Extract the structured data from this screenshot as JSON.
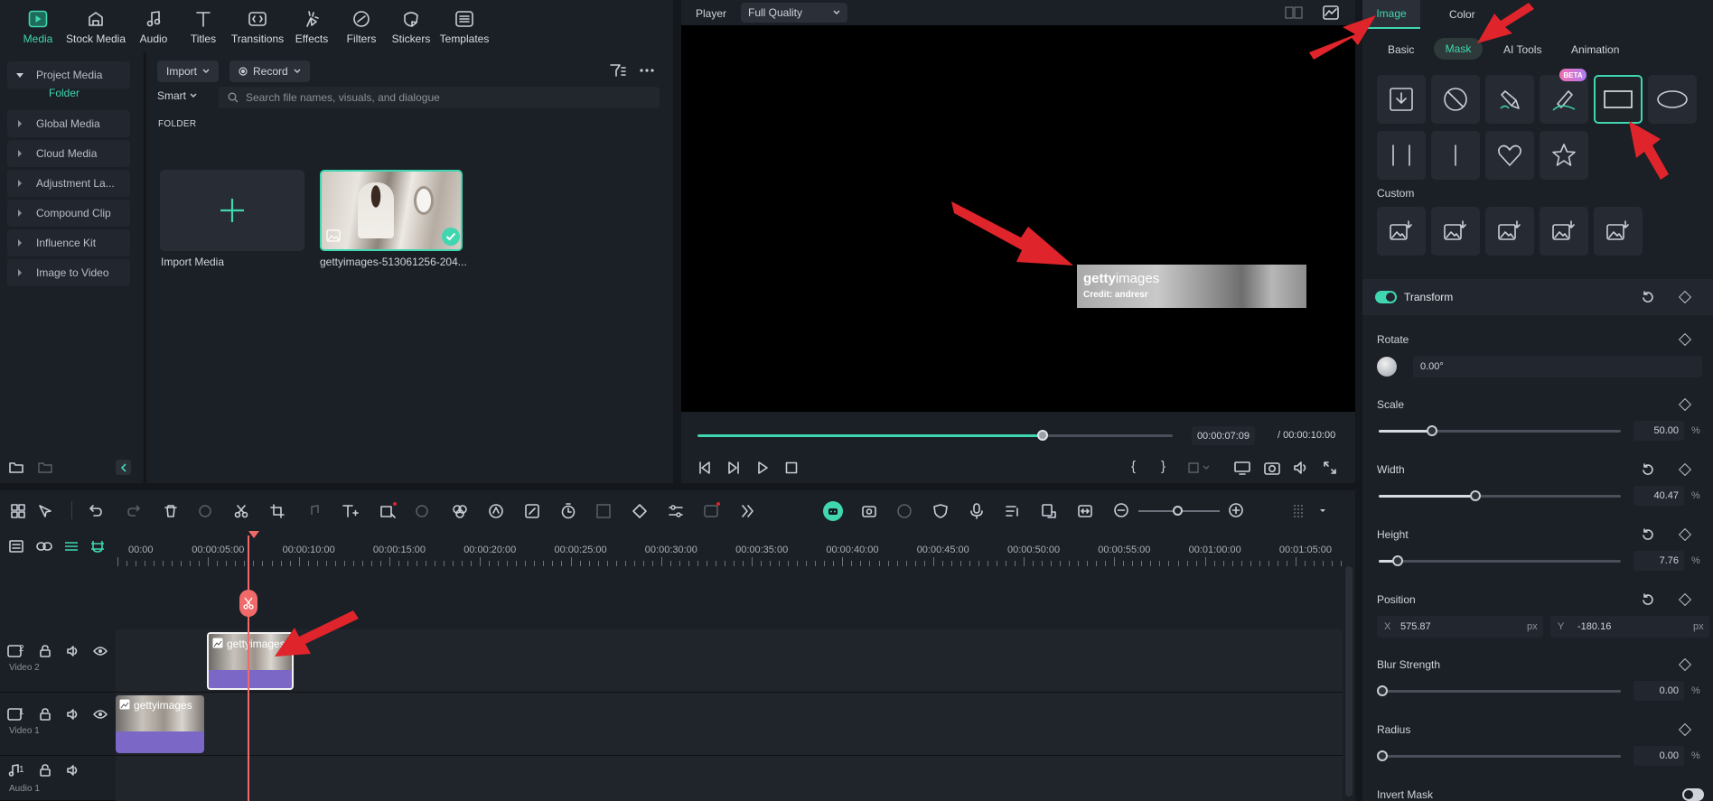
{
  "media_tabs": [
    {
      "label": "Media",
      "icon": "media-icon",
      "active": true
    },
    {
      "label": "Stock Media",
      "icon": "stock-media-icon"
    },
    {
      "label": "Audio",
      "icon": "music-note-icon"
    },
    {
      "label": "Titles",
      "icon": "text-icon"
    },
    {
      "label": "Transitions",
      "icon": "transitions-icon"
    },
    {
      "label": "Effects",
      "icon": "effects-icon"
    },
    {
      "label": "Filters",
      "icon": "filters-icon"
    },
    {
      "label": "Stickers",
      "icon": "sticker-icon"
    },
    {
      "label": "Templates",
      "icon": "templates-icon"
    }
  ],
  "left_panel": {
    "project_media": "Project Media",
    "folder": "Folder",
    "items": [
      "Global Media",
      "Cloud Media",
      "Adjustment La...",
      "Compound Clip",
      "Influence Kit",
      "Image to Video"
    ]
  },
  "media_main": {
    "import_label": "Import",
    "record_label": "Record",
    "smart_label": "Smart",
    "search_placeholder": "Search file names, visuals, and dialogue",
    "folder_header": "FOLDER",
    "import_media_label": "Import Media",
    "media_item_label": "gettyimages-513061256-204..."
  },
  "player": {
    "label": "Player",
    "quality": "Full Quality",
    "watermark_brand_bold": "getty",
    "watermark_brand_rest": "images",
    "watermark_credit": "Credit: andresr",
    "current_time": "00:00:07:09",
    "total_time": "/ 00:00:10:00",
    "progress": 0.727
  },
  "props": {
    "tabs": [
      "Image",
      "Color"
    ],
    "subtabs": [
      "Basic",
      "Mask",
      "AI Tools",
      "Animation"
    ],
    "beta": "BETA",
    "custom_label": "Custom",
    "transform_label": "Transform",
    "rotate_label": "Rotate",
    "rotate_value": "0.00°",
    "scale_label": "Scale",
    "scale_value": "50.00",
    "scale_fraction": 0.22,
    "width_label": "Width",
    "width_value": "40.47",
    "width_fraction": 0.4,
    "height_label": "Height",
    "height_value": "7.76",
    "height_fraction": 0.078,
    "position_label": "Position",
    "pos_x_label": "X",
    "pos_x_value": "575.87",
    "pos_y_label": "Y",
    "pos_y_value": "-180.16",
    "px_unit": "px",
    "percent_unit": "%",
    "blur_label": "Blur Strength",
    "blur_value": "0.00",
    "radius_label": "Radius",
    "radius_value": "0.00",
    "invert_label": "Invert Mask"
  },
  "timeline": {
    "ruler_labels": [
      "00:00",
      "00:00:05:00",
      "00:00:10:00",
      "00:00:15:00",
      "00:00:20:00",
      "00:00:25:00",
      "00:00:30:00",
      "00:00:35:00",
      "00:00:40:00",
      "00:00:45:00",
      "00:00:50:00",
      "00:00:55:00",
      "00:01:00:00",
      "00:01:05:00"
    ],
    "tracks": [
      {
        "num": "2",
        "name": "Video 2"
      },
      {
        "num": "1",
        "name": "Video 1"
      },
      {
        "num": "1",
        "name": "Audio 1"
      }
    ],
    "clip_text": "gettyimages"
  },
  "colors": {
    "accent": "#3fd6b0",
    "arrow": "#e0242b",
    "clip": "#7a67c6",
    "playhead": "#f06a6a"
  }
}
